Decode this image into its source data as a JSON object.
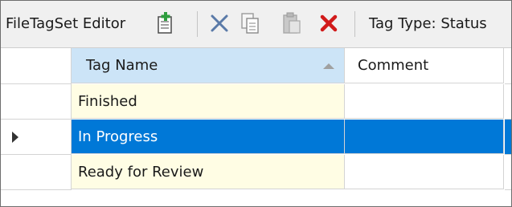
{
  "toolbar": {
    "title": "FileTagSet Editor",
    "tag_type_label": "Tag Type: Status",
    "icons": {
      "add": "add-icon",
      "cut": "cut-icon",
      "copy": "copy-icon",
      "paste": "paste-icon",
      "delete": "delete-icon"
    }
  },
  "grid": {
    "columns": [
      "Tag Name",
      "Comment"
    ],
    "sort_column": "Tag Name",
    "rows": [
      {
        "name": "Finished",
        "comment": ""
      },
      {
        "name": "In Progress",
        "comment": ""
      },
      {
        "name": "Ready for Review",
        "comment": ""
      }
    ],
    "selected_row": "In Progress"
  },
  "colors": {
    "selection": "#0078d7",
    "header_highlight": "#cce4f7",
    "name_cell_bg": "#fffde4",
    "delete_red": "#d11a1a",
    "add_green": "#2e9e3e"
  }
}
